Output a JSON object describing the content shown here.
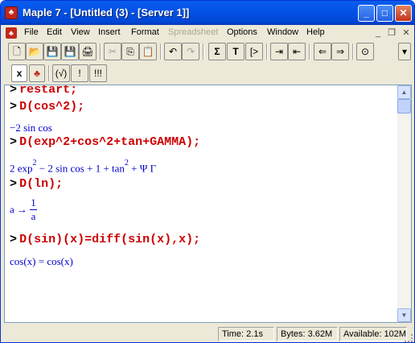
{
  "window": {
    "title": "Maple 7  - [Untitled (3) - [Server 1]]",
    "app_icon": "maple-leaf-icon"
  },
  "title_buttons": {
    "minimize": "_",
    "maximize": "□",
    "close": "✕"
  },
  "menu": [
    {
      "label": "File",
      "enabled": true
    },
    {
      "label": "Edit",
      "enabled": true
    },
    {
      "label": "View",
      "enabled": true
    },
    {
      "label": "Insert",
      "enabled": true
    },
    {
      "label": "Format",
      "enabled": true
    },
    {
      "label": "Spreadsheet",
      "enabled": false
    },
    {
      "label": "Options",
      "enabled": true
    },
    {
      "label": "Window",
      "enabled": true
    },
    {
      "label": "Help",
      "enabled": true
    }
  ],
  "mdi_buttons": {
    "minimize": "_",
    "restore": "❐",
    "close": "✕"
  },
  "toolbar": {
    "new": "🗋",
    "open": "📂",
    "save_all": "💾",
    "save": "💾",
    "print": "🖨",
    "cut": "✂",
    "copy": "⎘",
    "paste": "📋",
    "undo": "↶",
    "redo": "↷",
    "sigma": "Σ",
    "text": "T",
    "prompt": "[>",
    "indent": "⇥",
    "outdent": "⇤",
    "back": "⇐",
    "forward": "⇒",
    "stop": "⊙",
    "dropdown": "▾"
  },
  "context_bar": {
    "x_button": "x",
    "leaf_button": "♣",
    "eval_button": "(√)",
    "bang1": "!",
    "bang3": "!!!"
  },
  "worksheet": {
    "prompt_symbol": ">",
    "cmd1": "restart;",
    "cmd2": "D(cos^2);",
    "out2": "−2 sin cos",
    "cmd3": "D(exp^2+cos^2+tan+GAMMA);",
    "out3_a": "2 exp",
    "out3_b": "2",
    "out3_c": " − 2 sin cos + 1 + tan",
    "out3_d": "2",
    "out3_e": " + Ψ Γ",
    "cmd4": "D(ln);",
    "out4_var": "a",
    "out4_arrow": " → ",
    "out4_num": "1",
    "out4_den": "a",
    "cmd5": "D(sin)(x)=diff(sin(x),x);",
    "out5": "cos(x) = cos(x)"
  },
  "status": {
    "time": "Time:   2.1s",
    "bytes": "Bytes: 3.62M",
    "available": "Available: 102M"
  }
}
